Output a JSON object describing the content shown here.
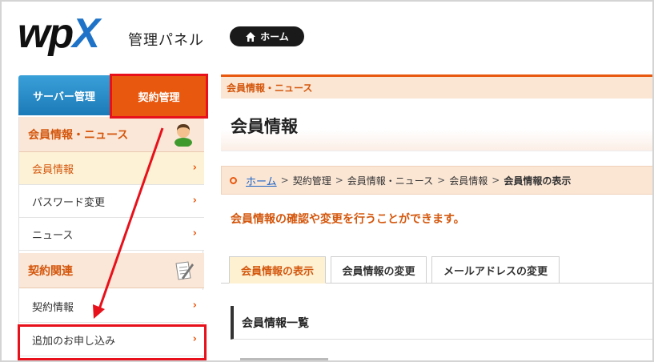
{
  "header": {
    "logo_main": "wp",
    "logo_x": "X",
    "panel_title": "管理パネル",
    "home_button": "ホーム"
  },
  "top_tabs": {
    "server": "サーバー管理",
    "contract": "契約管理"
  },
  "sidebar": {
    "section_member": "会員情報・ニュース",
    "items_member": [
      {
        "label": "会員情報"
      },
      {
        "label": "パスワード変更"
      },
      {
        "label": "ニュース"
      }
    ],
    "section_contract": "契約関連",
    "items_contract": [
      {
        "label": "契約情報"
      },
      {
        "label": "追加のお申し込み"
      }
    ],
    "chevron": "›"
  },
  "main": {
    "category": "会員情報・ニュース",
    "title": "会員情報",
    "breadcrumb": {
      "home": "ホーム",
      "sep": ">",
      "items": [
        "契約管理",
        "会員情報・ニュース",
        "会員情報"
      ],
      "current": "会員情報の表示"
    },
    "lead": "会員情報の確認や変更を行うことができます。",
    "tabs": [
      {
        "label": "会員情報の表示"
      },
      {
        "label": "会員情報の変更"
      },
      {
        "label": "メールアドレスの変更"
      }
    ],
    "list_heading": "会員情報一覧"
  },
  "colors": {
    "accent_orange": "#e8580f",
    "server_blue": "#1b7ab8",
    "highlight_red": "#e8111b",
    "link_blue": "#1e64c8"
  }
}
